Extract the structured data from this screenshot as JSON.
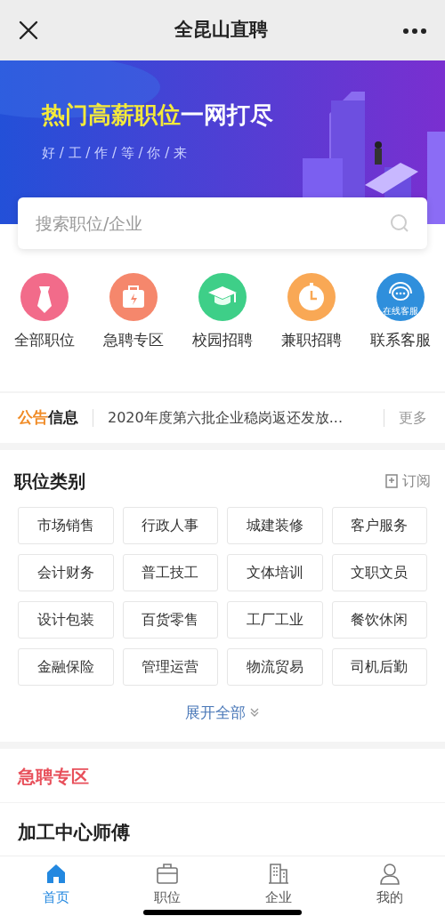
{
  "header": {
    "title": "全昆山直聘"
  },
  "banner": {
    "kind": "picture",
    "title_highlight": "热门高薪职位",
    "title_rest": "一网打尽",
    "subtitle": "好 / 工 / 作 / 等 / 你 / 来"
  },
  "search": {
    "placeholder": "搜索职位/企业"
  },
  "shortcuts": [
    {
      "label": "全部职位",
      "kind": "tie",
      "color": "#f26b8a"
    },
    {
      "label": "急聘专区",
      "kind": "bag",
      "color": "#f5876c"
    },
    {
      "label": "校园招聘",
      "kind": "cap",
      "color": "#3ecf88"
    },
    {
      "label": "兼职招聘",
      "kind": "clock",
      "color": "#f9a855"
    },
    {
      "label": "联系客服",
      "kind": "service",
      "color": "#2f8fdc",
      "badge_text": "在线客服"
    }
  ],
  "notice": {
    "label_highlight": "公告",
    "label_rest": "信息",
    "text": "2020年度第六批企业稳岗返还发放...",
    "more": "更多"
  },
  "categories": {
    "title": "职位类别",
    "subscribe": "订阅",
    "expand": "展开全部",
    "items": [
      "市场销售",
      "行政人事",
      "城建装修",
      "客户服务",
      "会计财务",
      "普工技工",
      "文体培训",
      "文职文员",
      "设计包装",
      "百货零售",
      "工厂工业",
      "餐饮休闲",
      "金融保险",
      "管理运营",
      "物流贸易",
      "司机后勤"
    ]
  },
  "urgent": {
    "title": "急聘专区",
    "jobs": [
      {
        "title": "加工中心师傅"
      }
    ]
  },
  "tabbar": [
    {
      "label": "首页",
      "kind": "home",
      "selected": true
    },
    {
      "label": "职位",
      "kind": "briefcase",
      "selected": false
    },
    {
      "label": "企业",
      "kind": "building",
      "selected": false
    },
    {
      "label": "我的",
      "kind": "person",
      "selected": false
    }
  ]
}
